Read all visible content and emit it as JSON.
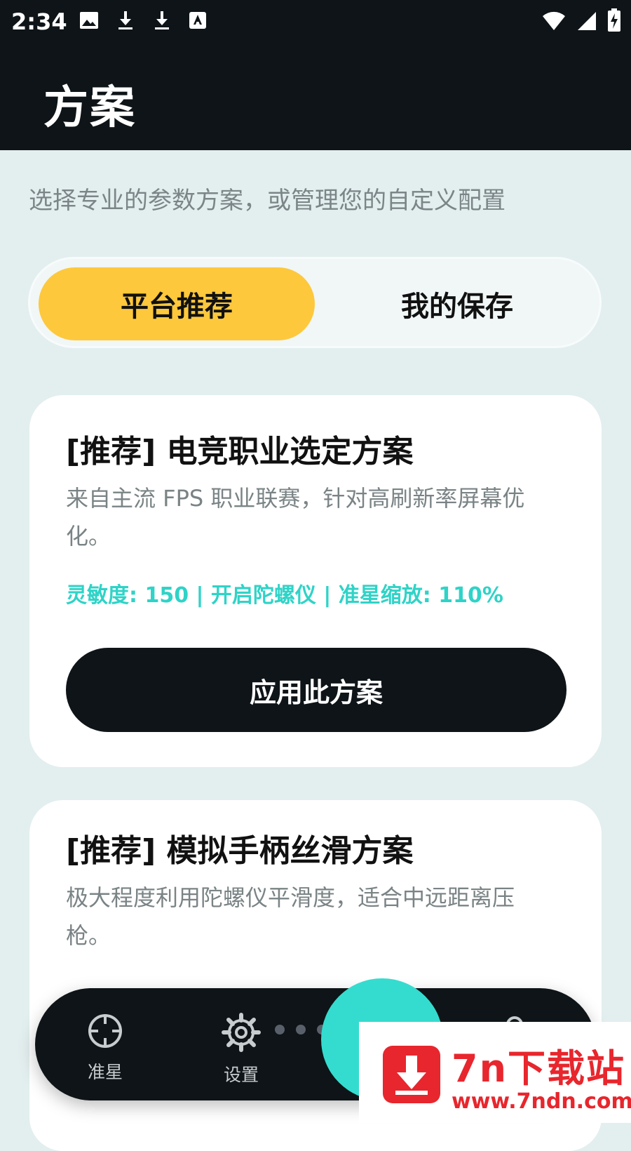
{
  "status_bar": {
    "time": "2:34",
    "left_icons": [
      "image-icon",
      "download-icon",
      "download-icon",
      "font-icon"
    ],
    "right_icons": [
      "wifi-icon",
      "signal-icon",
      "battery-charging-icon"
    ]
  },
  "app_bar": {
    "title": "方案"
  },
  "subtitle": "选择专业的参数方案，或管理您的自定义配置",
  "tabs": [
    {
      "label": "平台推荐",
      "active": true
    },
    {
      "label": "我的保存",
      "active": false
    }
  ],
  "cards": [
    {
      "title": "[推荐] 电竞职业选定方案",
      "description": "来自主流 FPS 职业联赛，针对高刷新率屏幕优化。",
      "params": "灵敏度: 150 | 开启陀螺仪 | 准星缩放: 110%",
      "apply_label": "应用此方案"
    },
    {
      "title": "[推荐] 模拟手柄丝滑方案",
      "description": "极大程度利用陀螺仪平滑度，适合中远距离压枪。"
    }
  ],
  "bottom_nav": {
    "items": [
      {
        "label": "准星",
        "icon": "crosshair-icon"
      },
      {
        "label": "设置",
        "icon": "gear-icon"
      },
      {
        "label": "",
        "icon": "grid-icon"
      },
      {
        "label": "",
        "icon": "user-icon"
      }
    ],
    "page_dots": 4,
    "active_dot": 3
  },
  "watermark": {
    "main": "7n下载站",
    "url": "www.7ndn.com"
  },
  "colors": {
    "accent_yellow": "#fdc83b",
    "accent_teal": "#2fd3c7",
    "dark": "#0e1417",
    "background": "#e3eeef"
  }
}
